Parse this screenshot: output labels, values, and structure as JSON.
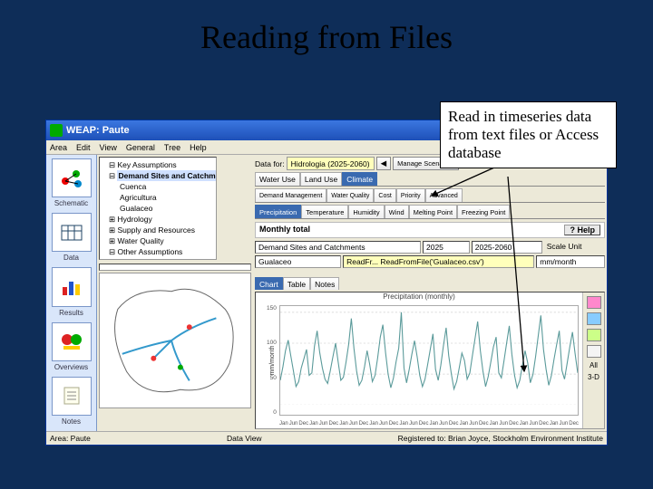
{
  "slide": {
    "title": "Reading from Files"
  },
  "callout": {
    "text": "Read in timeseries data from text files or Access database"
  },
  "window": {
    "title": "WEAP: Paute",
    "menus": [
      "Area",
      "Edit",
      "View",
      "General",
      "Tree",
      "Help"
    ],
    "win_buttons": {
      "min": "_",
      "max": "□",
      "close": "✕"
    }
  },
  "leftnav": [
    {
      "label": "Schematic",
      "name": "nav-schematic"
    },
    {
      "label": "Data",
      "name": "nav-data"
    },
    {
      "label": "Results",
      "name": "nav-results"
    },
    {
      "label": "Overviews",
      "name": "nav-overviews"
    },
    {
      "label": "Notes",
      "name": "nav-notes"
    }
  ],
  "tree": {
    "items": [
      {
        "label": "Key Assumptions",
        "indent": 1
      },
      {
        "label": "Demand Sites and Catchments",
        "indent": 1,
        "boxed": true
      },
      {
        "label": "Cuenca",
        "indent": 2
      },
      {
        "label": "Agricultura",
        "indent": 2
      },
      {
        "label": "Gualaceo",
        "indent": 2
      },
      {
        "label": "Hydrology",
        "indent": 1
      },
      {
        "label": "Supply and Resources",
        "indent": 1
      },
      {
        "label": "Water Quality",
        "indent": 1
      },
      {
        "label": "Other Assumptions",
        "indent": 1
      }
    ]
  },
  "datafor": {
    "label": "Data for:",
    "value": "Hidrologia (2025-2060)",
    "nav_prev": "◀",
    "nav_text": "Manage Scenarios"
  },
  "tabs1": [
    "Water Use",
    "Land Use",
    "Climate"
  ],
  "tabs1_active": 2,
  "tabs2": [
    "Demand Management",
    "Water Quality",
    "Cost",
    "Priority",
    "Advanced"
  ],
  "tabs3": [
    "Precipitation",
    "Temperature",
    "Humidity",
    "Wind",
    "Melting Point",
    "Freezing Point"
  ],
  "tabs3_active": 0,
  "help_row": {
    "title": "Monthly total",
    "help": "?  Help"
  },
  "selectors": {
    "s1": "Demand Sites and Catchments",
    "s2": "2025",
    "s3": "2025-2060",
    "s4": "Scale  Unit",
    "s5": "Gualaceo",
    "s6": "ReadFromFile('Gualaceo.csv')",
    "s7": "mm/month"
  },
  "inner_tabs": [
    "Chart",
    "Table",
    "Notes"
  ],
  "inner_tabs_active": 0,
  "view_buttons": [
    "All",
    "3-D"
  ],
  "chart_data": {
    "type": "line",
    "title": "Precipitation (monthly)",
    "ylabel": "mm/month",
    "ylim": [
      0,
      160
    ],
    "yticks": [
      0,
      50,
      100,
      150
    ],
    "xticks_repeat": [
      "Jan",
      "Jun",
      "Dec"
    ],
    "xticks_count": 10,
    "series": [
      {
        "name": "Gualaceo",
        "values": [
          40,
          62,
          88,
          105,
          80,
          55,
          30,
          38,
          60,
          75,
          90,
          48,
          52,
          95,
          120,
          85,
          60,
          42,
          35,
          55,
          78,
          100,
          70,
          40,
          45,
          70,
          98,
          140,
          92,
          55,
          32,
          40,
          62,
          88,
          65,
          38,
          48,
          76,
          110,
          130,
          85,
          50,
          28,
          44,
          70,
          92,
          150,
          60,
          36,
          58,
          82,
          104,
          78,
          48,
          30,
          42,
          66,
          90,
          115,
          58,
          40,
          64,
          96,
          125,
          80,
          50,
          26,
          38,
          60,
          84,
          72,
          42,
          52,
          80,
          108,
          135,
          88,
          55,
          30,
          46,
          70,
          94,
          110,
          52,
          44,
          72,
          100,
          128,
          82,
          48,
          28,
          40,
          64,
          88,
          68,
          36,
          50,
          78,
          112,
          145,
          90,
          58,
          32,
          48,
          74,
          98,
          120,
          56,
          42,
          68,
          94,
          118,
          84,
          52
        ]
      }
    ]
  },
  "statusbar": {
    "left": "Area: Paute",
    "center": "Data View",
    "right": "Registered to: Brian Joyce, Stockholm Environment Institute"
  }
}
